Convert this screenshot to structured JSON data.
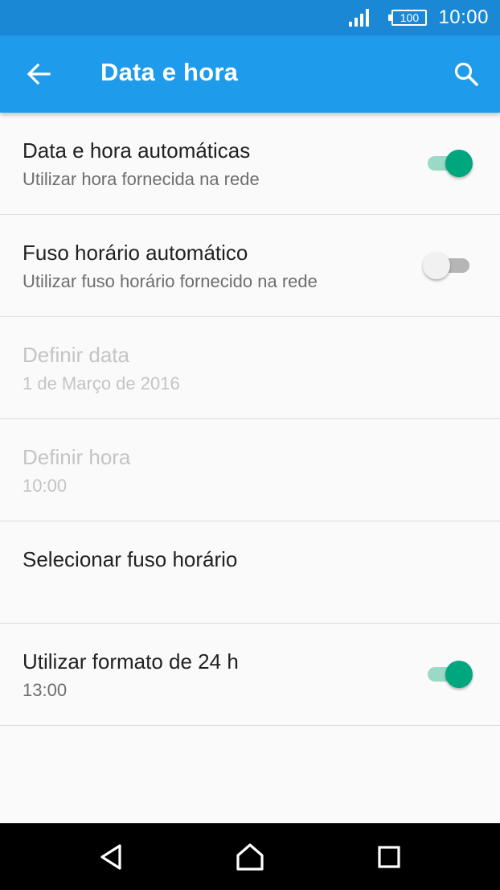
{
  "status_bar": {
    "battery_level": "100",
    "time": "10:00",
    "icons": [
      "signal-icon",
      "battery-icon"
    ]
  },
  "app_bar": {
    "title": "Data e hora",
    "back_icon": "arrow-left-icon",
    "search_icon": "search-icon"
  },
  "settings": [
    {
      "title": "Data e hora automáticas",
      "summary": "Utilizar hora fornecida na rede",
      "toggle": "on",
      "enabled": true
    },
    {
      "title": "Fuso horário automático",
      "summary": "Utilizar fuso horário fornecido na rede",
      "toggle": "off",
      "enabled": true
    },
    {
      "title": "Definir data",
      "summary": "1 de Março de 2016",
      "enabled": false
    },
    {
      "title": "Definir hora",
      "summary": "10:00",
      "enabled": false
    },
    {
      "title": "Selecionar fuso horário",
      "summary": "",
      "enabled": true
    },
    {
      "title": "Utilizar formato de 24 h",
      "summary": "13:00",
      "toggle": "on",
      "enabled": true
    }
  ],
  "colors": {
    "status_bar": "#1b88d6",
    "app_bar": "#1e9bea",
    "toggle_accent": "#00a67e",
    "disabled_text": "#c4c4c4"
  },
  "nav_bar": {
    "icons": [
      "back-triangle-icon",
      "home-icon",
      "recents-icon"
    ]
  }
}
